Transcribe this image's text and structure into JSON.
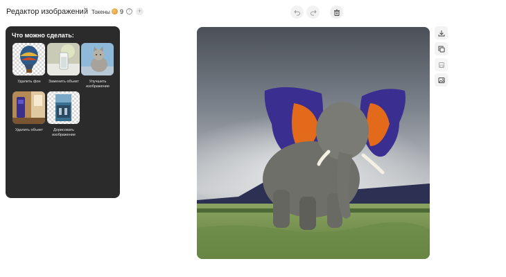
{
  "header": {
    "title": "Редактор изображений",
    "tokens_label": "Токены",
    "tokens_count": "9",
    "help_symbol": "?",
    "add_symbol": "+"
  },
  "panel": {
    "title": "Что можно сделать:",
    "tools": [
      {
        "label": "Удалить фон"
      },
      {
        "label": "Заменить объект"
      },
      {
        "label": "Улучшить изображение"
      },
      {
        "label": "Удалить объект"
      },
      {
        "label": "Дорисовать изображение"
      }
    ]
  },
  "icons": {
    "undo": "undo-icon",
    "redo": "redo-icon",
    "delete": "trash-icon",
    "download": "download-icon",
    "copy": "copy-icon",
    "save": "save-icon",
    "image": "image-icon"
  }
}
